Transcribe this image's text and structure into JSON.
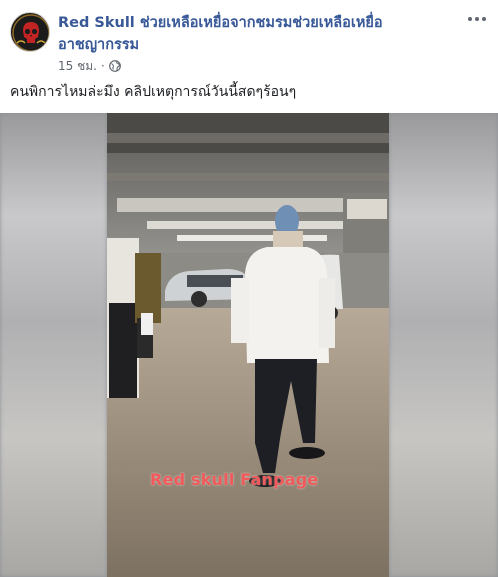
{
  "post": {
    "author": "Red Skull ช่วยเหลือเหยื่อจากชมรมช่วยเหลือเหยื่ออาชญากรรม",
    "time": "15 ชม.",
    "separator": "·",
    "privacy_icon": "globe-icon",
    "caption": "คนพิการไหมล่ะมึง คลิปเหตุการณ์วันนี้สดๆร้อนๆ",
    "more_icon": "more-options-icon"
  },
  "video": {
    "watermark": "Red skull Fanpage",
    "colors": {
      "watermark": "#f05a5a",
      "author_link": "#385898",
      "meta_text": "#616770"
    }
  }
}
